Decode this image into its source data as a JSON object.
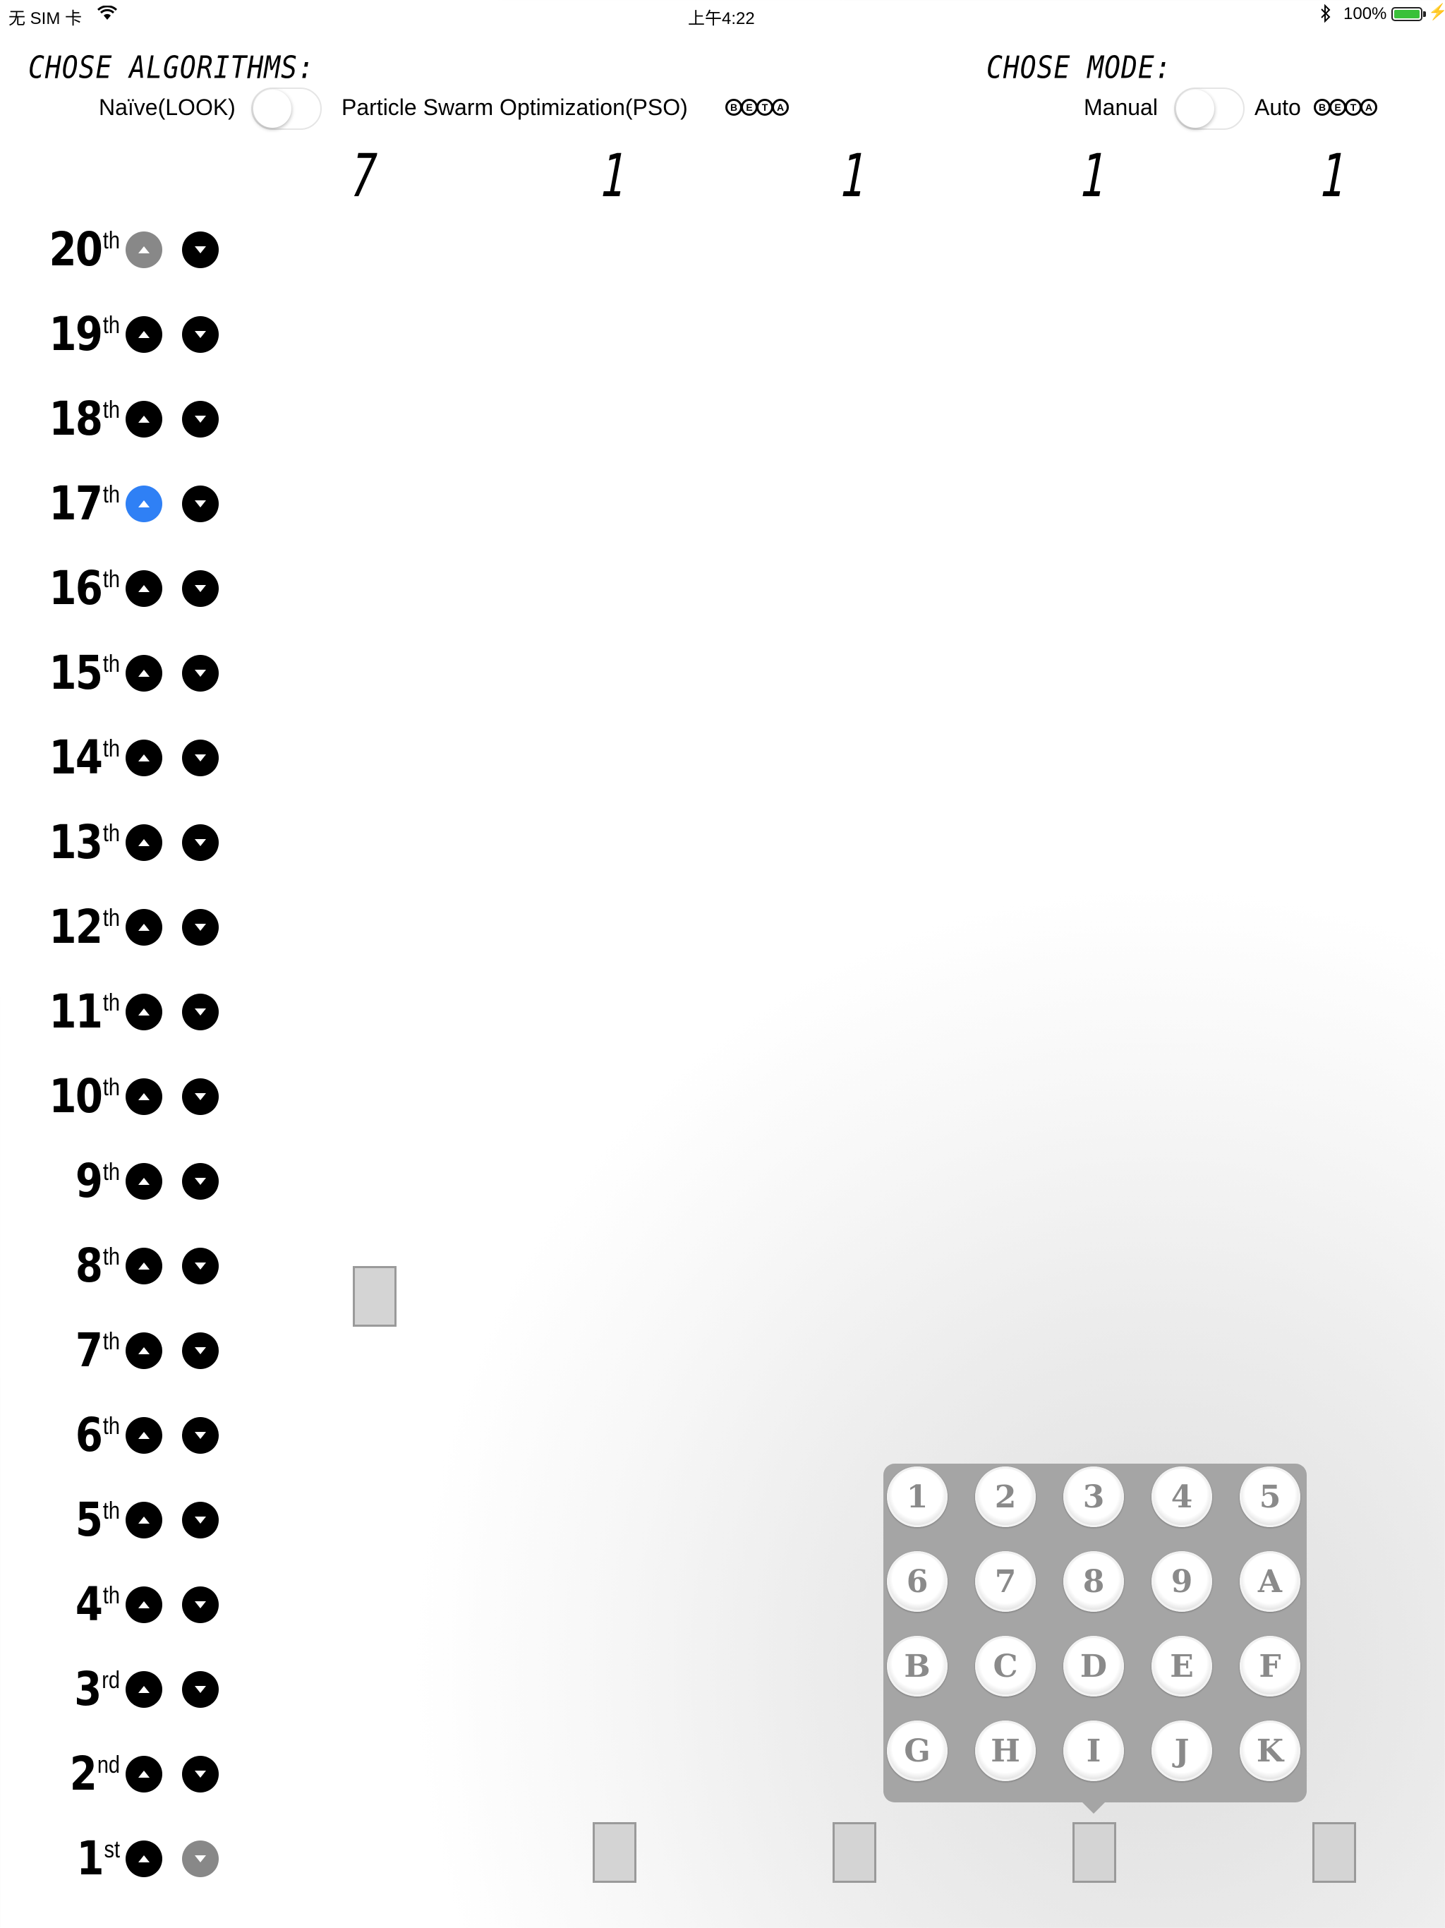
{
  "status_bar": {
    "carrier": "无 SIM 卡",
    "time": "上午4:22",
    "battery": "100%",
    "wifi_icon": "wifi-icon",
    "bluetooth_icon": "bluetooth-icon"
  },
  "algorithm": {
    "title": "CHOSE ALGORITHMS:",
    "left_label": "Naïve(LOOK)",
    "right_label": "Particle Swarm Optimization(PSO)",
    "beta": [
      "B",
      "E",
      "T",
      "A"
    ]
  },
  "mode": {
    "title": "CHOSE MODE:",
    "left_label": "Manual",
    "right_label": "Auto",
    "beta": [
      "B",
      "E",
      "T",
      "A"
    ]
  },
  "displays": [
    "7",
    "1",
    "1",
    "1",
    "1"
  ],
  "floors": [
    {
      "num": "20",
      "suf": "th"
    },
    {
      "num": "19",
      "suf": "th"
    },
    {
      "num": "18",
      "suf": "th"
    },
    {
      "num": "17",
      "suf": "th"
    },
    {
      "num": "16",
      "suf": "th"
    },
    {
      "num": "15",
      "suf": "th"
    },
    {
      "num": "14",
      "suf": "th"
    },
    {
      "num": "13",
      "suf": "th"
    },
    {
      "num": "12",
      "suf": "th"
    },
    {
      "num": "11",
      "suf": "th"
    },
    {
      "num": "10",
      "suf": "th"
    },
    {
      "num": "9",
      "suf": "th"
    },
    {
      "num": "8",
      "suf": "th"
    },
    {
      "num": "7",
      "suf": "th"
    },
    {
      "num": "6",
      "suf": "th"
    },
    {
      "num": "5",
      "suf": "th"
    },
    {
      "num": "4",
      "suf": "th"
    },
    {
      "num": "3",
      "suf": "rd"
    },
    {
      "num": "2",
      "suf": "nd"
    },
    {
      "num": "1",
      "suf": "st"
    }
  ],
  "keypad": [
    "1",
    "2",
    "3",
    "4",
    "5",
    "6",
    "7",
    "8",
    "9",
    "A",
    "B",
    "C",
    "D",
    "E",
    "F",
    "G",
    "H",
    "I",
    "J",
    "K"
  ],
  "colors": {
    "active_call": "#2f80f5",
    "disabled": "#888888",
    "keypad_bg": "#a5a5a5"
  }
}
